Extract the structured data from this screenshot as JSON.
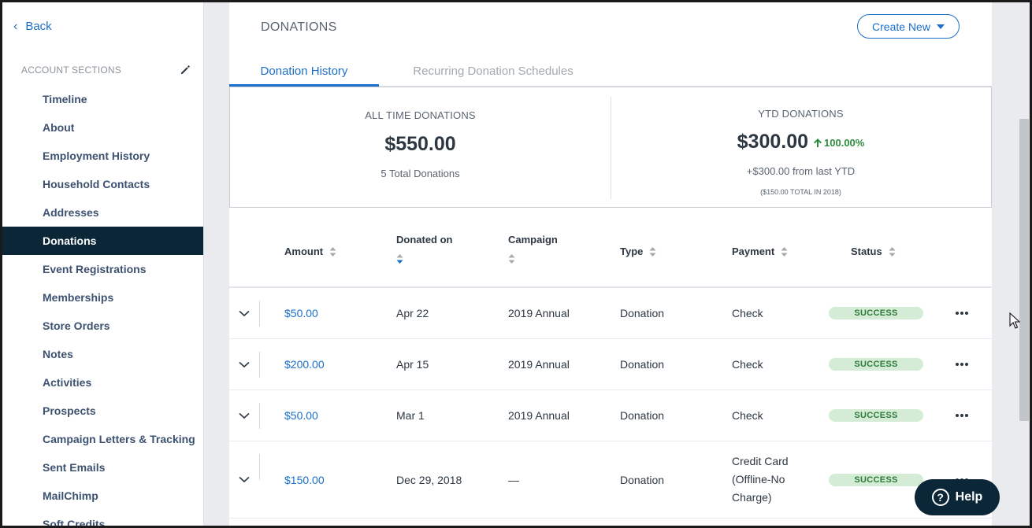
{
  "sidebar": {
    "back_label": "Back",
    "section_title": "ACCOUNT SECTIONS",
    "items": [
      {
        "label": "Timeline"
      },
      {
        "label": "About"
      },
      {
        "label": "Employment History"
      },
      {
        "label": "Household Contacts"
      },
      {
        "label": "Addresses"
      },
      {
        "label": "Donations",
        "active": true
      },
      {
        "label": "Event Registrations"
      },
      {
        "label": "Memberships"
      },
      {
        "label": "Store Orders"
      },
      {
        "label": "Notes"
      },
      {
        "label": "Activities"
      },
      {
        "label": "Prospects"
      },
      {
        "label": "Campaign Letters & Tracking"
      },
      {
        "label": "Sent Emails"
      },
      {
        "label": "MailChimp"
      },
      {
        "label": "Soft Credits"
      }
    ]
  },
  "main": {
    "title": "DONATIONS",
    "create_label": "Create New",
    "tabs": [
      {
        "label": "Donation History",
        "active": true
      },
      {
        "label": "Recurring Donation Schedules"
      }
    ]
  },
  "summary": {
    "all_time": {
      "label": "ALL TIME DONATIONS",
      "value": "$550.00",
      "sub": "5 Total Donations"
    },
    "ytd": {
      "label": "YTD DONATIONS",
      "value": "$300.00",
      "growth": "100.00%",
      "sub": "+$300.00 from last YTD",
      "note": "($150.00 TOTAL IN 2018)"
    }
  },
  "table": {
    "headers": {
      "amount": "Amount",
      "donated_on": "Donated on",
      "campaign": "Campaign",
      "type": "Type",
      "payment": "Payment",
      "status": "Status"
    },
    "rows": [
      {
        "amount": "$50.00",
        "date": "Apr 22",
        "campaign": "2019 Annual",
        "type": "Donation",
        "payment": "Check",
        "status": "SUCCESS"
      },
      {
        "amount": "$200.00",
        "date": "Apr 15",
        "campaign": "2019 Annual",
        "type": "Donation",
        "payment": "Check",
        "status": "SUCCESS"
      },
      {
        "amount": "$50.00",
        "date": "Mar 1",
        "campaign": "2019 Annual",
        "type": "Donation",
        "payment": "Check",
        "status": "SUCCESS"
      },
      {
        "amount": "$150.00",
        "date": "Dec 29, 2018",
        "campaign": "—",
        "type": "Donation",
        "payment_lines": [
          "Credit Card",
          "(Offline-No",
          "Charge)"
        ],
        "status": "SUCCESS"
      }
    ]
  },
  "help": {
    "label": "Help"
  },
  "colors": {
    "accent": "#1b6fc8",
    "nav_active": "#0b2637",
    "success_bg": "#d4ecd6",
    "success_text": "#2e7a38",
    "growth": "#2e8b3d"
  }
}
